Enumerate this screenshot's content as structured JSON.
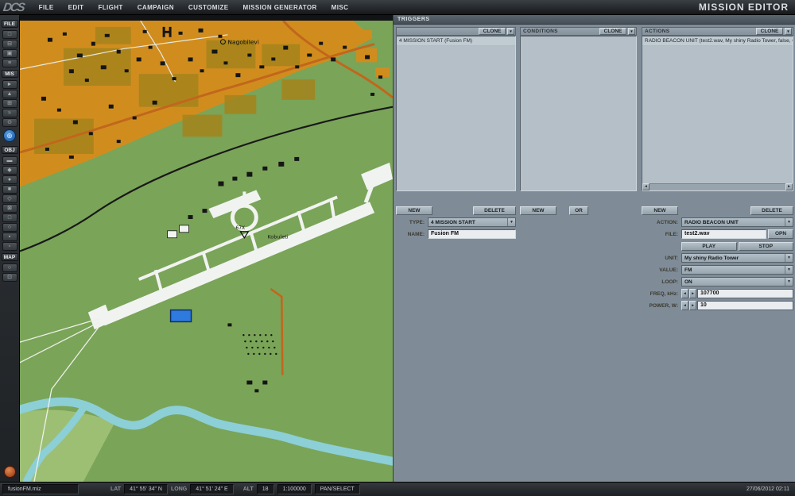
{
  "colors": {
    "panel_bg": "#7f8c98",
    "list_bg": "#b5bfc7",
    "button_face": "#a4b1bb",
    "title_bar": "#4d565e",
    "map_green": "#7aa458",
    "map_urban": "#d08d1e",
    "map_water": "#8ccfd6",
    "map_road_orange": "#c2661c",
    "runway_white": "#f1f3f1",
    "selection_blue": "#2e7ade",
    "statusbar_bg": "#26292d"
  },
  "icons": {
    "dropdown": "▼",
    "left": "◂",
    "right": "▸",
    "scroll": "▾"
  },
  "app": {
    "logo": "DCS",
    "title": "MISSION EDITOR",
    "menus": [
      "FILE",
      "EDIT",
      "FLIGHT",
      "CAMPAIGN",
      "CUSTOMIZE",
      "MISSION GENERATOR",
      "MISC"
    ]
  },
  "toolbar": {
    "items": [
      {
        "text": "FILE"
      },
      {
        "glyph": "□"
      },
      {
        "glyph": "⊟"
      },
      {
        "glyph": "▣"
      },
      {
        "glyph": "≡"
      },
      {
        "text": "MIS"
      },
      {
        "glyph": "►"
      },
      {
        "glyph": "▲"
      },
      {
        "glyph": "⊞"
      },
      {
        "glyph": "≈"
      },
      {
        "glyph": "⊙"
      },
      {
        "glyph": "⊕"
      },
      {
        "text": "OBJ"
      },
      {
        "glyph": "▬"
      },
      {
        "glyph": "◆"
      },
      {
        "glyph": "●"
      },
      {
        "glyph": "■"
      },
      {
        "glyph": "◇"
      },
      {
        "glyph": "⊠"
      },
      {
        "glyph": "□"
      },
      {
        "glyph": "○"
      },
      {
        "glyph": "▪"
      },
      {
        "glyph": "▫"
      },
      {
        "text": "MAP"
      },
      {
        "glyph": "○"
      },
      {
        "glyph": "⊡"
      }
    ]
  },
  "map": {
    "labels": {
      "town": "Nagobilevi",
      "airfield": "Kobuleti",
      "tacan": "67X"
    }
  },
  "panel": {
    "title": "TRIGGERS",
    "conditions_header": "CONDITIONS",
    "actions_header": "ACTIONS",
    "clone_label": "CLONE",
    "new_label": "NEW",
    "delete_label": "DELETE",
    "or_label": "OR",
    "trigger_item": "4 MISSION START (Fusion FM)",
    "action_item": "RADIO BEACON UNIT (test2.wav, My shiny Radio Tower, false, O",
    "fields": {
      "type_label": "TYPE:",
      "type_value": "4 MISSION START",
      "name_label": "NAME:",
      "name_value": "Fusion FM",
      "action_label": "ACTION:",
      "action_value": "RADIO BEACON UNIT",
      "file_label": "FILE:",
      "file_value": "test2.wav",
      "open_label": "OPN",
      "play_label": "PLAY",
      "stop_label": "STOP",
      "unit_label": "UNIT:",
      "unit_value": "My shiny Radio Tower",
      "value_label": "VALUE:",
      "value_value": "FM",
      "loop_label": "LOOP:",
      "loop_value": "ON",
      "freq_label": "FREQ, kHz:",
      "freq_value": "107700",
      "power_label": "POWER, W:",
      "power_value": "10"
    }
  },
  "statusbar": {
    "filename": "fusionFM.miz",
    "lat_label": "LAT",
    "lat_value": "41° 55' 34\" N",
    "long_label": "LONG",
    "long_value": "41° 51' 24\" E",
    "alt_label": "ALT",
    "alt_value": "18",
    "scale": "1:100000",
    "mode": "PAN/SELECT",
    "datetime": "27/06/2012 02:11"
  }
}
